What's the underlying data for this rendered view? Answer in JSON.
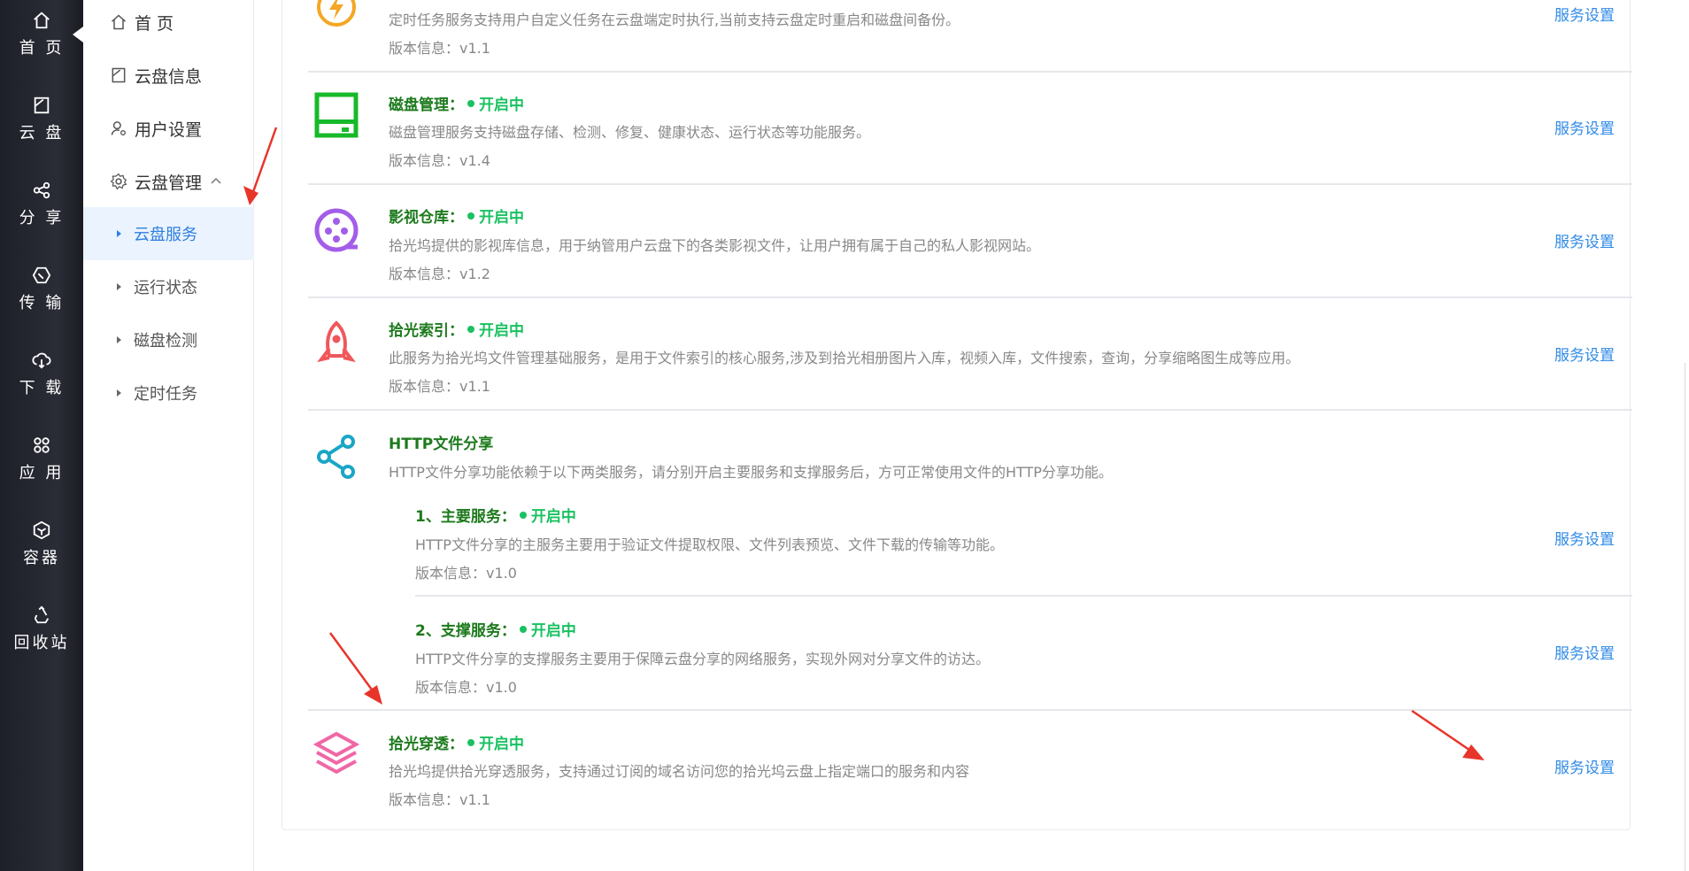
{
  "rail": {
    "items": [
      {
        "label": "首 页",
        "icon": "home-icon"
      },
      {
        "label": "云 盘",
        "icon": "cloud-disk-icon"
      },
      {
        "label": "分 享",
        "icon": "share-icon"
      },
      {
        "label": "传 输",
        "icon": "transfer-icon"
      },
      {
        "label": "下 载",
        "icon": "download-icon"
      },
      {
        "label": "应 用",
        "icon": "apps-icon"
      },
      {
        "label": "容器",
        "icon": "container-icon"
      },
      {
        "label": "回收站",
        "icon": "recycle-icon"
      }
    ]
  },
  "sidebar": {
    "items": [
      {
        "label": "首 页",
        "icon": "home-icon"
      },
      {
        "label": "云盘信息",
        "icon": "disk-info-icon"
      },
      {
        "label": "用户设置",
        "icon": "user-settings-icon"
      },
      {
        "label": "云盘管理",
        "icon": "gear-icon"
      }
    ],
    "subitems": [
      {
        "label": "云盘服务",
        "active": true
      },
      {
        "label": "运行状态",
        "active": false
      },
      {
        "label": "磁盘检测",
        "active": false
      },
      {
        "label": "定时任务",
        "active": false
      }
    ]
  },
  "services": {
    "settings_label": "服务设置",
    "status_label": "开启中",
    "timer": {
      "desc": "定时任务服务支持用户自定义任务在云盘端定时执行,当前支持云盘定时重启和磁盘间备份。",
      "version": "版本信息：v1.1"
    },
    "disk": {
      "title": "磁盘管理：",
      "desc": "磁盘管理服务支持磁盘存储、检测、修复、健康状态、运行状态等功能服务。",
      "version": "版本信息：v1.4"
    },
    "media": {
      "title": "影视仓库：",
      "desc": "拾光坞提供的影视库信息，用于纳管用户云盘下的各类影视文件，让用户拥有属于自己的私人影视网站。",
      "version": "版本信息：v1.2"
    },
    "index": {
      "title": "拾光索引：",
      "desc": "此服务为拾光坞文件管理基础服务，是用于文件索引的核心服务,涉及到拾光相册图片入库，视频入库，文件搜索，查询，分享缩略图生成等应用。",
      "version": "版本信息：v1.1"
    },
    "http": {
      "title": "HTTP文件分享",
      "desc": "HTTP文件分享功能依赖于以下两类服务，请分别开启主要服务和支撑服务后，方可正常使用文件的HTTP分享功能。",
      "main": {
        "title": "1、主要服务：",
        "desc": "HTTP文件分享的主服务主要用于验证文件提取权限、文件列表预览、文件下载的传输等功能。",
        "version": "版本信息：v1.0"
      },
      "support": {
        "title": "2、支撑服务：",
        "desc": "HTTP文件分享的支撑服务主要用于保障云盘分享的网络服务，实现外网对分享文件的访达。",
        "version": "版本信息：v1.0"
      }
    },
    "tunnel": {
      "title": "拾光穿透：",
      "desc": "拾光坞提供拾光穿透服务，支持通过订阅的域名访问您的拾光坞云盘上指定端口的服务和内容",
      "version": "版本信息：v1.1"
    }
  },
  "colors": {
    "title_green": "#1d7a1d",
    "status_green": "#19c160",
    "link_blue": "#2f8ae6",
    "active_bg": "#eaf3fe",
    "arrow_red": "#e8352a"
  }
}
